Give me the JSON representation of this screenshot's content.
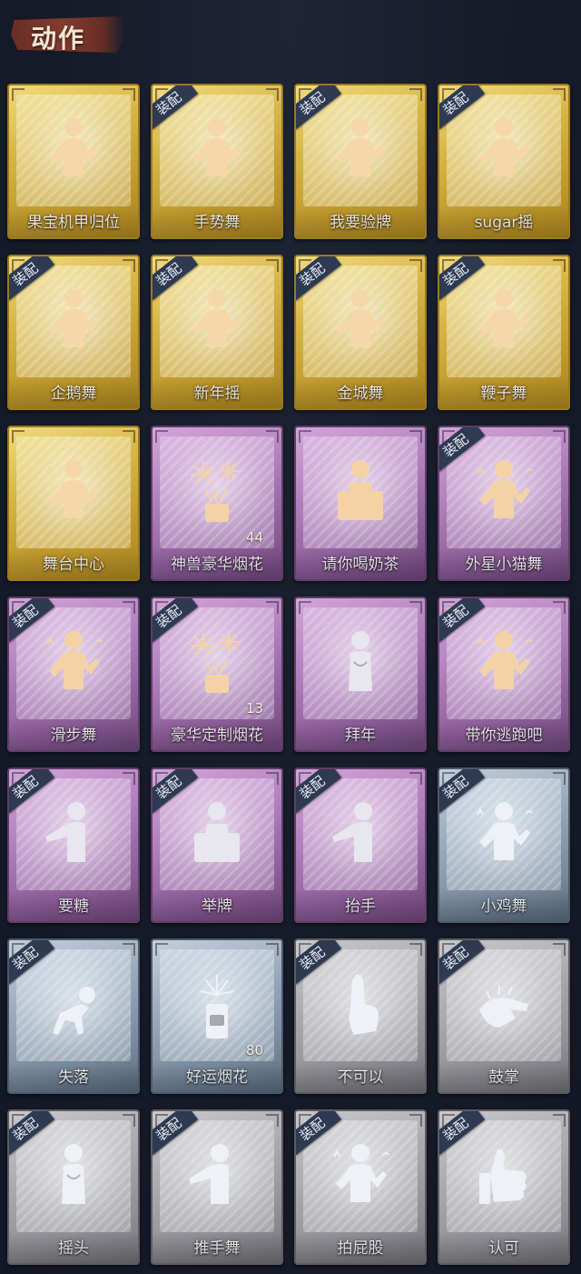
{
  "header": {
    "title": "动作"
  },
  "equip_badge_text": "装配",
  "cards": [
    {
      "label": "果宝机甲归位",
      "tier": "gold",
      "equipped": false,
      "count": "",
      "icon": "dance-figure-icon"
    },
    {
      "label": "手势舞",
      "tier": "gold",
      "equipped": true,
      "count": "",
      "icon": "dance-figure-icon"
    },
    {
      "label": "我要验牌",
      "tier": "gold",
      "equipped": true,
      "count": "",
      "icon": "dance-figure-icon"
    },
    {
      "label": "sugar摇",
      "tier": "gold",
      "equipped": true,
      "count": "",
      "icon": "dance-figure-icon"
    },
    {
      "label": "企鹅舞",
      "tier": "gold",
      "equipped": true,
      "count": "",
      "icon": "dance-figure-icon"
    },
    {
      "label": "新年摇",
      "tier": "gold",
      "equipped": true,
      "count": "",
      "icon": "dance-figure-icon"
    },
    {
      "label": "金城舞",
      "tier": "gold",
      "equipped": true,
      "count": "",
      "icon": "dance-figure-icon"
    },
    {
      "label": "鞭子舞",
      "tier": "gold",
      "equipped": true,
      "count": "",
      "icon": "dance-figure-icon"
    },
    {
      "label": "舞台中心",
      "tier": "gold",
      "equipped": false,
      "count": "",
      "icon": "dance-figure-icon"
    },
    {
      "label": "神兽豪华烟花",
      "tier": "purple",
      "equipped": false,
      "count": "44",
      "icon": "fireworks-icon"
    },
    {
      "label": "请你喝奶茶",
      "tier": "purple",
      "equipped": false,
      "count": "",
      "icon": "sign-board-icon"
    },
    {
      "label": "外星小猫舞",
      "tier": "purple",
      "equipped": true,
      "count": "",
      "icon": "dance-figure-icon"
    },
    {
      "label": "滑步舞",
      "tier": "purple",
      "equipped": true,
      "count": "",
      "icon": "dance-figure-icon"
    },
    {
      "label": "豪华定制烟花",
      "tier": "purple",
      "equipped": true,
      "count": "13",
      "icon": "fireworks-icon"
    },
    {
      "label": "拜年",
      "tier": "purple",
      "equipped": false,
      "count": "",
      "icon": "bow-figure-icon"
    },
    {
      "label": "带你逃跑吧",
      "tier": "purple",
      "equipped": true,
      "count": "",
      "icon": "dance-figure-icon"
    },
    {
      "label": "要糖",
      "tier": "purple",
      "equipped": true,
      "count": "",
      "icon": "reach-figure-icon"
    },
    {
      "label": "举牌",
      "tier": "purple",
      "equipped": true,
      "count": "",
      "icon": "sign-board-icon"
    },
    {
      "label": "抬手",
      "tier": "purple",
      "equipped": true,
      "count": "",
      "icon": "reach-figure-icon"
    },
    {
      "label": "小鸡舞",
      "tier": "blue",
      "equipped": true,
      "count": "",
      "icon": "dance-figure-icon"
    },
    {
      "label": "失落",
      "tier": "blue",
      "equipped": true,
      "count": "",
      "icon": "kneel-figure-icon"
    },
    {
      "label": "好运烟花",
      "tier": "blue",
      "equipped": false,
      "count": "80",
      "icon": "firecracker-icon"
    },
    {
      "label": "不可以",
      "tier": "gray",
      "equipped": true,
      "count": "",
      "icon": "finger-wag-icon"
    },
    {
      "label": "鼓掌",
      "tier": "gray",
      "equipped": true,
      "count": "",
      "icon": "clap-icon"
    },
    {
      "label": "摇头",
      "tier": "gray",
      "equipped": true,
      "count": "",
      "icon": "bow-figure-icon"
    },
    {
      "label": "推手舞",
      "tier": "gray",
      "equipped": true,
      "count": "",
      "icon": "reach-figure-icon"
    },
    {
      "label": "拍屁股",
      "tier": "gray",
      "equipped": true,
      "count": "",
      "icon": "dance-figure-icon"
    },
    {
      "label": "认可",
      "tier": "gray",
      "equipped": true,
      "count": "",
      "icon": "thumbs-up-icon"
    }
  ]
}
